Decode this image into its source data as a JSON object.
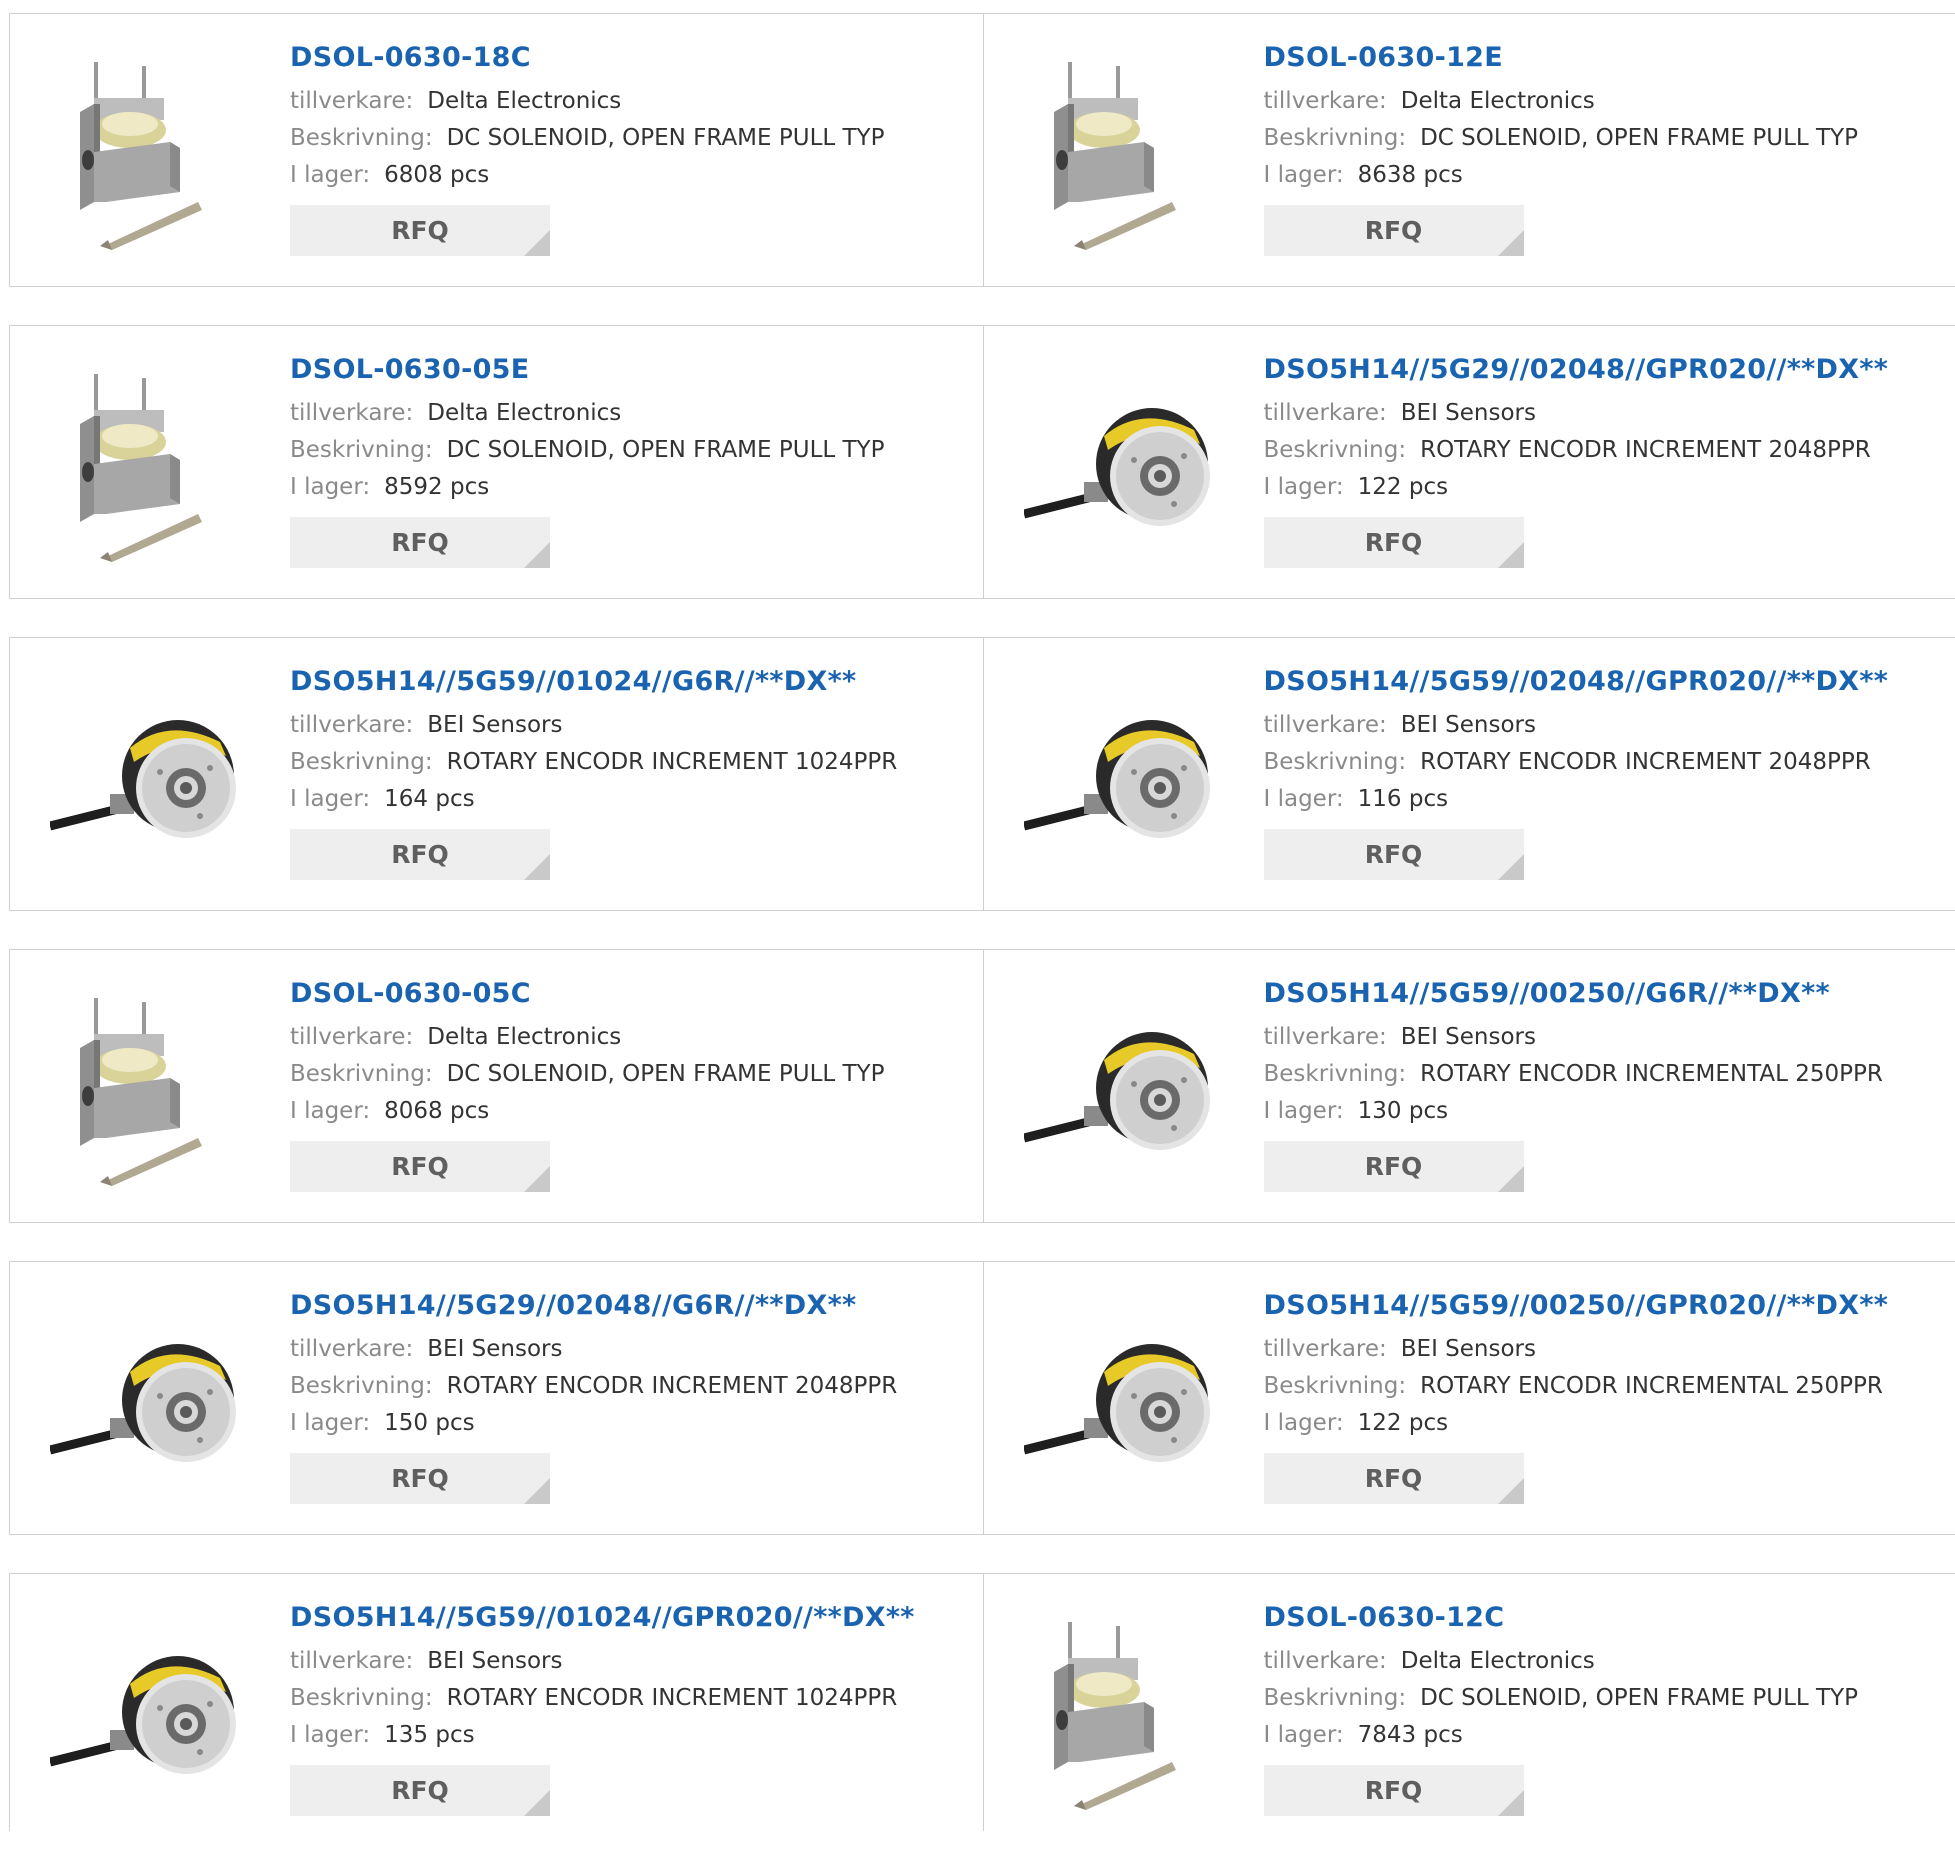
{
  "labels": {
    "manufacturer": "tillverkare:",
    "description": "Beskrivning:",
    "stock": "I lager:",
    "rfq": "RFQ"
  },
  "products": [
    {
      "part": "DSOL-0630-18C",
      "manufacturer": "Delta Electronics",
      "description": "DC SOLENOID, OPEN FRAME PULL TYP",
      "stock": "6808 pcs",
      "image": "solenoid"
    },
    {
      "part": "DSOL-0630-12E",
      "manufacturer": "Delta Electronics",
      "description": "DC SOLENOID, OPEN FRAME PULL TYP",
      "stock": "8638 pcs",
      "image": "solenoid"
    },
    {
      "part": "DSOL-0630-05E",
      "manufacturer": "Delta Electronics",
      "description": "DC SOLENOID, OPEN FRAME PULL TYP",
      "stock": "8592 pcs",
      "image": "solenoid"
    },
    {
      "part": "DSO5H14//5G29//02048//GPR020//**DX**",
      "manufacturer": "BEI Sensors",
      "description": "ROTARY ENCODR INCREMENT 2048PPR",
      "stock": "122 pcs",
      "image": "encoder"
    },
    {
      "part": "DSO5H14//5G59//01024//G6R//**DX**",
      "manufacturer": "BEI Sensors",
      "description": "ROTARY ENCODR INCREMENT 1024PPR",
      "stock": "164 pcs",
      "image": "encoder"
    },
    {
      "part": "DSO5H14//5G59//02048//GPR020//**DX**",
      "manufacturer": "BEI Sensors",
      "description": "ROTARY ENCODR INCREMENT 2048PPR",
      "stock": "116 pcs",
      "image": "encoder"
    },
    {
      "part": "DSOL-0630-05C",
      "manufacturer": "Delta Electronics",
      "description": "DC SOLENOID, OPEN FRAME PULL TYP",
      "stock": "8068 pcs",
      "image": "solenoid"
    },
    {
      "part": "DSO5H14//5G59//00250//G6R//**DX**",
      "manufacturer": "BEI Sensors",
      "description": "ROTARY ENCODR INCREMENTAL 250PPR",
      "stock": "130 pcs",
      "image": "encoder"
    },
    {
      "part": "DSO5H14//5G29//02048//G6R//**DX**",
      "manufacturer": "BEI Sensors",
      "description": "ROTARY ENCODR INCREMENT 2048PPR",
      "stock": "150 pcs",
      "image": "encoder"
    },
    {
      "part": "DSO5H14//5G59//00250//GPR020//**DX**",
      "manufacturer": "BEI Sensors",
      "description": "ROTARY ENCODR INCREMENTAL 250PPR",
      "stock": "122 pcs",
      "image": "encoder"
    },
    {
      "part": "DSO5H14//5G59//01024//GPR020//**DX**",
      "manufacturer": "BEI Sensors",
      "description": "ROTARY ENCODR INCREMENT 1024PPR",
      "stock": "135 pcs",
      "image": "encoder"
    },
    {
      "part": "DSOL-0630-12C",
      "manufacturer": "Delta Electronics",
      "description": "DC SOLENOID, OPEN FRAME PULL TYP",
      "stock": "7843 pcs",
      "image": "solenoid"
    }
  ]
}
